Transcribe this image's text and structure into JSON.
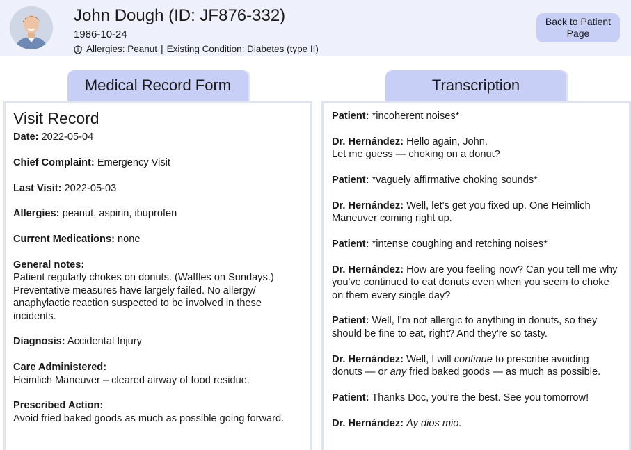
{
  "header": {
    "name": "John Dough (ID: JF876-332)",
    "dob": "1986-10-24",
    "allergies": "Allergies: Peanut",
    "separator": "|",
    "condition": "Existing Condition: Diabetes (type II)",
    "back_label": "Back to Patient Page"
  },
  "tabs": {
    "form": "Medical Record Form",
    "transcription": "Transcription"
  },
  "form": {
    "title": "Visit Record",
    "fields": [
      {
        "label": "Date:",
        "value": "2022-05-04"
      },
      {
        "label": "Chief Complaint:",
        "value": "Emergency Visit"
      },
      {
        "label": "Last Visit:",
        "value": "2022-05-03"
      },
      {
        "label": "Allergies:",
        "value": "peanut, aspirin, ibuprofen"
      },
      {
        "label": "Current Medications:",
        "value": "none"
      },
      {
        "label": "General notes:",
        "value": "Patient regularly chokes on donuts. (Waffles on Sundays.) Preventative measures have largely failed. No allergy/ anaphylactic reaction suspected to be involved in these incidents."
      },
      {
        "label": "Diagnosis:",
        "value": "Accidental Injury"
      },
      {
        "label": "Care Administered:",
        "value": "Heimlich Maneuver – cleared airway of food residue."
      },
      {
        "label": "Prescribed Action:",
        "value": "Avoid fried baked goods as much as possible going forward."
      }
    ]
  },
  "transcript": [
    {
      "speaker": "Patient:",
      "parts": [
        {
          "t": "*incoherent noises*"
        }
      ]
    },
    {
      "speaker": "Dr. Hernández:",
      "parts": [
        {
          "t": "Hello again, John."
        },
        {
          "br": true
        },
        {
          "t": "Let me guess — choking on a donut?"
        }
      ]
    },
    {
      "speaker": "Patient:",
      "parts": [
        {
          "t": "*vaguely affirmative choking sounds*"
        }
      ]
    },
    {
      "speaker": "Dr. Hernández:",
      "parts": [
        {
          "t": "Well, let's get you fixed up. One Heimlich Maneuver coming right up."
        }
      ]
    },
    {
      "speaker": "Patient:",
      "parts": [
        {
          "t": "*intense coughing and retching noises*"
        }
      ]
    },
    {
      "speaker": "Dr. Hernández:",
      "parts": [
        {
          "t": "How are you feeling now? Can you tell me why you've continued to eat donuts even when you seem to choke on them every single day?"
        }
      ]
    },
    {
      "speaker": "Patient:",
      "parts": [
        {
          "t": "Well, I'm not allergic to anything in donuts, so they should be fine to eat, right? And they're so tasty."
        }
      ]
    },
    {
      "speaker": "Dr. Hernández:",
      "parts": [
        {
          "t": "Well, I will "
        },
        {
          "t": "continue",
          "i": true
        },
        {
          "t": " to prescribe avoiding donuts — or "
        },
        {
          "t": "any",
          "i": true
        },
        {
          "t": " fried baked goods — as much as possible."
        }
      ]
    },
    {
      "speaker": "Patient:",
      "parts": [
        {
          "t": "Thanks Doc, you're the best. See you tomorrow!"
        }
      ]
    },
    {
      "speaker": "Dr. Hernández:",
      "parts": [
        {
          "t": "Ay dios mio.",
          "i": true
        }
      ]
    }
  ]
}
